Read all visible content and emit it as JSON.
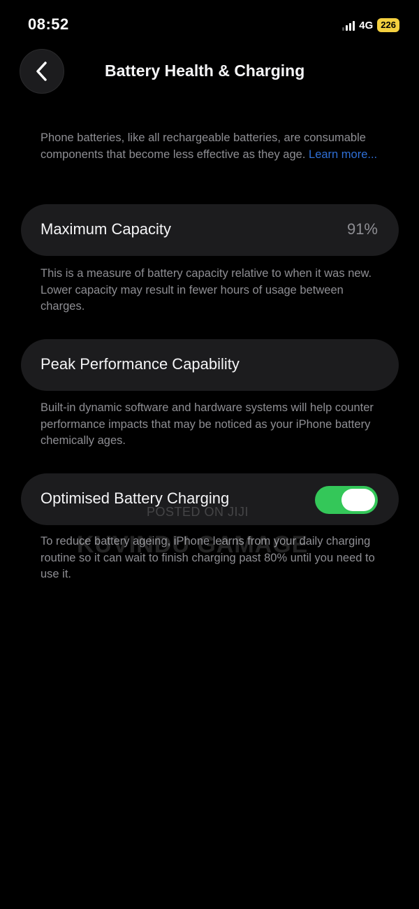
{
  "status_bar": {
    "time": "08:52",
    "network": "4G",
    "battery": "226",
    "colors": {
      "battery_badge": "#f4d03f"
    }
  },
  "nav": {
    "back_icon": "chevron-left-icon",
    "title": "Battery Health & Charging"
  },
  "intro": {
    "text": "Phone batteries, like all rechargeable batteries, are consumable components that become less effective as they age. ",
    "link": "Learn more..."
  },
  "max_capacity": {
    "label": "Maximum Capacity",
    "value": "91%",
    "description": "This is a measure of battery capacity relative to when it was new. Lower capacity may result in fewer hours of usage between charges."
  },
  "peak_performance": {
    "label": "Peak Performance Capability",
    "description": "Built-in dynamic software and hardware systems will help counter performance impacts that may be noticed as your iPhone battery chemically ages."
  },
  "optimised_charging": {
    "label": "Optimised Battery Charging",
    "enabled": true,
    "description": "To reduce battery ageing, iPhone learns from your daily charging routine so it can wait to finish charging past 80% until you need to use it.",
    "colors": {
      "toggle_on": "#34c759"
    }
  },
  "watermark": {
    "site": "POSTED ON JIJI",
    "name": "KUVINDU GAMAGE"
  },
  "colors": {
    "background": "#000000",
    "card": "#1c1c1e",
    "secondary_text": "#8e8e93",
    "link": "#2f6fd6"
  }
}
